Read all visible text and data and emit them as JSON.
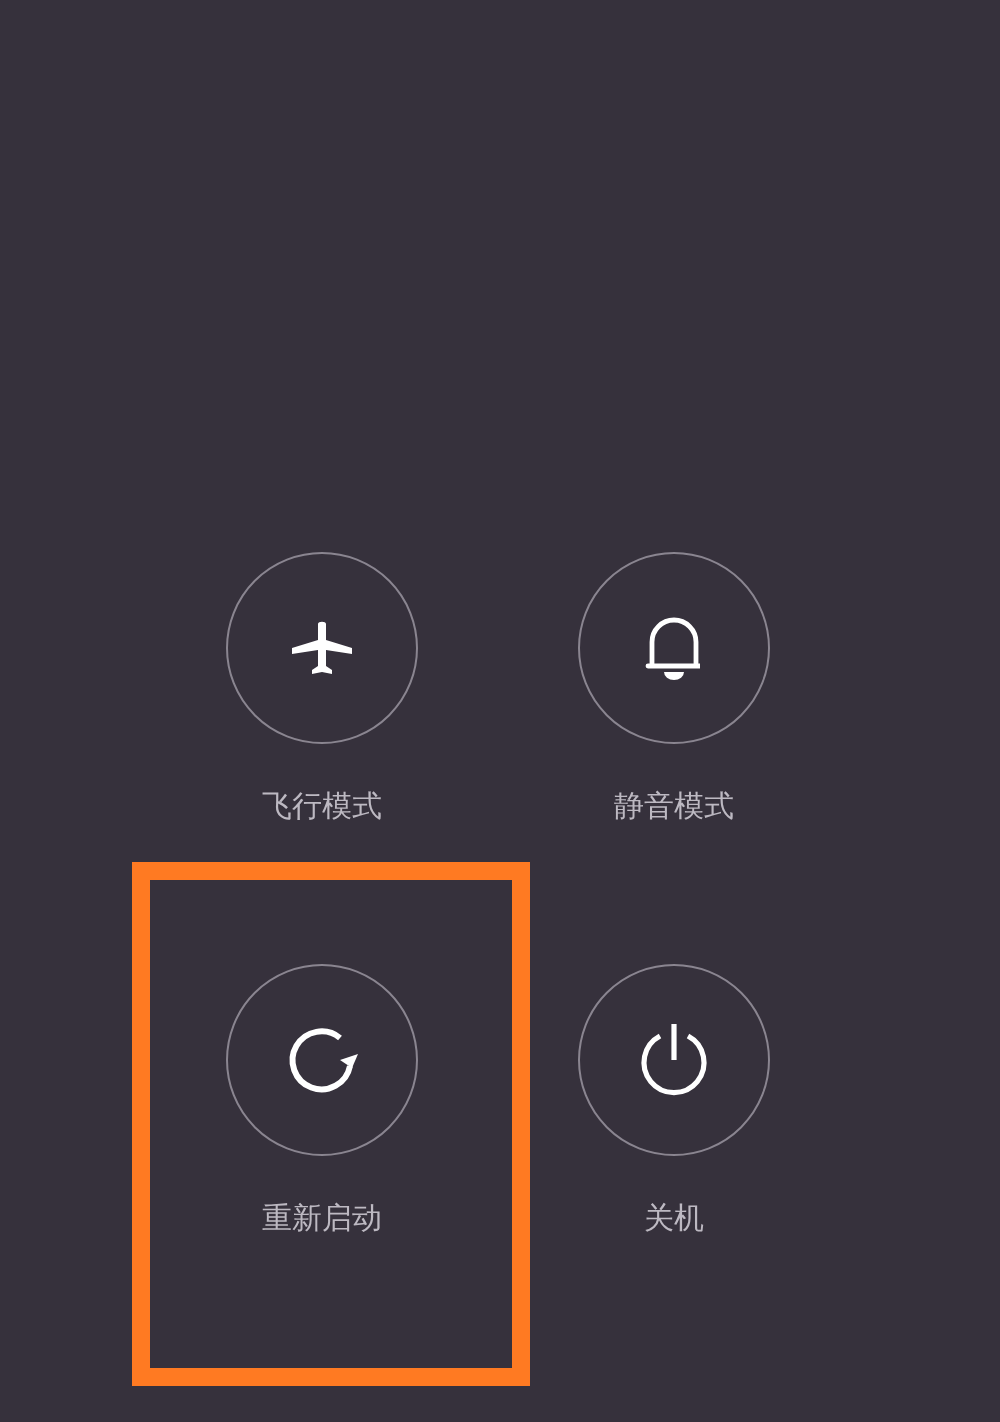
{
  "power_menu": {
    "items": [
      {
        "kind": "airplane",
        "label": "飞行模式",
        "highlighted": false
      },
      {
        "kind": "bell",
        "label": "静音模式",
        "highlighted": false
      },
      {
        "kind": "restart",
        "label": "重新启动",
        "highlighted": true
      },
      {
        "kind": "power",
        "label": "关机",
        "highlighted": false
      }
    ]
  }
}
